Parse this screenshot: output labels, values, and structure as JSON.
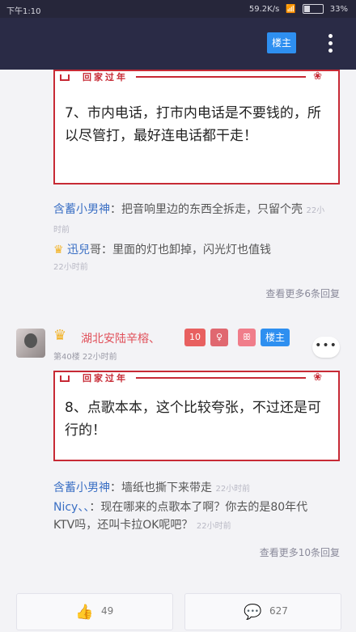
{
  "status": {
    "time": "下午1:10",
    "speed": "59.2K/s",
    "battery": "33%",
    "battery_level": 0.33
  },
  "header": {
    "louzhu_label": "楼主"
  },
  "card1": {
    "banner_title": "回家过年",
    "text": "7、市内电话，打市内电话是不要钱的，所以尽管打，最好连电话都干走！"
  },
  "comments1": [
    {
      "user": "含蓄小男神",
      "text": "：把音响里边的东西全拆走，只留个壳",
      "time": "22小时前"
    },
    {
      "user": "迅兒",
      "text": "哥：里面的灯也卸掉，闪光灯也值钱",
      "time": "22小时前"
    }
  ],
  "more1": "查看更多6条回复",
  "post2": {
    "username": "湖北安陆辛榕、",
    "floor": "第40楼",
    "time": "22小时前",
    "level": "10",
    "louzhu_label": "楼主",
    "more_label": "•••"
  },
  "card2": {
    "banner_title": "回家过年",
    "text": "8、点歌本本，这个比较夸张，不过还是可行的！"
  },
  "comments2": [
    {
      "user": "含蓄小男神",
      "text": "：墙纸也撕下来带走",
      "time": "22小时前"
    },
    {
      "user": "Nicy、、",
      "text": "：现在哪来的点歌本了啊？你去的是80年代KTV吗，还叫卡拉OK呢吧？",
      "time": "22小时前"
    }
  ],
  "more2": "查看更多10条回复",
  "bottom": {
    "likes": "49",
    "comments": "627"
  },
  "icons": {
    "like": "thumbs-up-icon",
    "comment": "speech-bubble-icon",
    "crown": "crown-icon"
  }
}
